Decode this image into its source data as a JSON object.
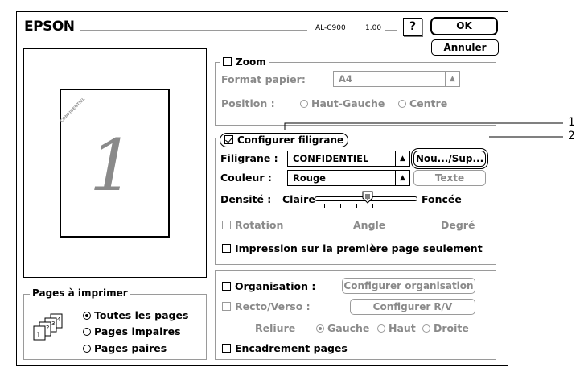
{
  "header": {
    "brand": "EPSON",
    "model": "AL-C900",
    "version": "1.00",
    "help": "?",
    "ok": "OK",
    "cancel": "Annuler"
  },
  "preview": {
    "page_number": "1",
    "watermark_text": "CONFIDENTIEL"
  },
  "zoom": {
    "label": "Zoom",
    "format_label": "Format papier:",
    "format_value": "A4",
    "position_label": "Position :",
    "pos_option1": "Haut-Gauche",
    "pos_option2": "Centre"
  },
  "watermark": {
    "config_label": "Configurer filigrane",
    "filigrane_label": "Filigrane :",
    "filigrane_value": "CONFIDENTIEL",
    "new_del_button": "Nou.../Sup...",
    "couleur_label": "Couleur :",
    "couleur_value": "Rouge",
    "text_button": "Texte",
    "densite_label": "Densité :",
    "light": "Claire",
    "dark": "Foncée",
    "density_level": 0.52,
    "rotation_label": "Rotation",
    "angle_label": "Angle",
    "degree_label": "Degré",
    "first_page_label": "Impression sur la première page seulement"
  },
  "pages": {
    "title": "Pages à imprimer",
    "all": "Toutes les pages",
    "odd": "Pages impaires",
    "even": "Pages paires",
    "icon_digits": [
      "1",
      "2",
      "3",
      "4"
    ]
  },
  "layout": {
    "organisation_label": "Organisation :",
    "organisation_button": "Configurer organisation",
    "duplex_label": "Recto/Verso :",
    "duplex_button": "Configurer R/V",
    "binding_label": "Reliure",
    "left": "Gauche",
    "top": "Haut",
    "right": "Droite",
    "border_label": "Encadrement pages"
  },
  "callouts": {
    "one": "1",
    "two": "2"
  }
}
